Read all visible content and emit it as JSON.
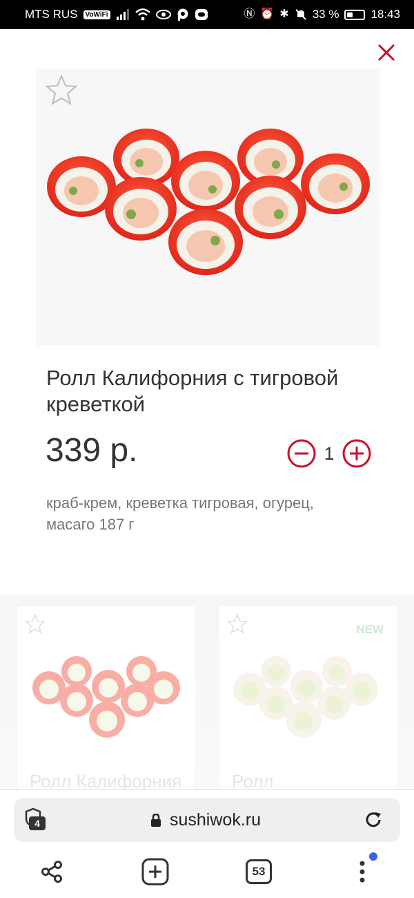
{
  "status_bar": {
    "carrier": "MTS RUS",
    "vowifi": "VoWiFi",
    "battery": "33 %",
    "battery_level": 0.33,
    "time": "18:43"
  },
  "product": {
    "title": "Ролл Калифорния с тигровой креветкой",
    "price": "339 р.",
    "quantity": "1",
    "description": "краб-крем, креветка тигровая, огурец, масаго 187 г"
  },
  "recommendations": [
    {
      "title": "Ролл Калифорния",
      "badge": ""
    },
    {
      "title": "Ролл",
      "badge": "NEW"
    }
  ],
  "browser": {
    "tab_shield_count": "4",
    "url": "sushiwok.ru",
    "tabs_count": "53"
  },
  "colors": {
    "accent": "#c8102e",
    "new_badge": "#a8d5a8",
    "notification": "#3a62e8"
  },
  "icons": [
    "close-icon",
    "star-outline-icon",
    "minus-circle-icon",
    "plus-circle-icon",
    "lock-icon",
    "reload-icon",
    "share-icon",
    "add-box-icon",
    "tabs-icon",
    "more-vert-icon"
  ]
}
